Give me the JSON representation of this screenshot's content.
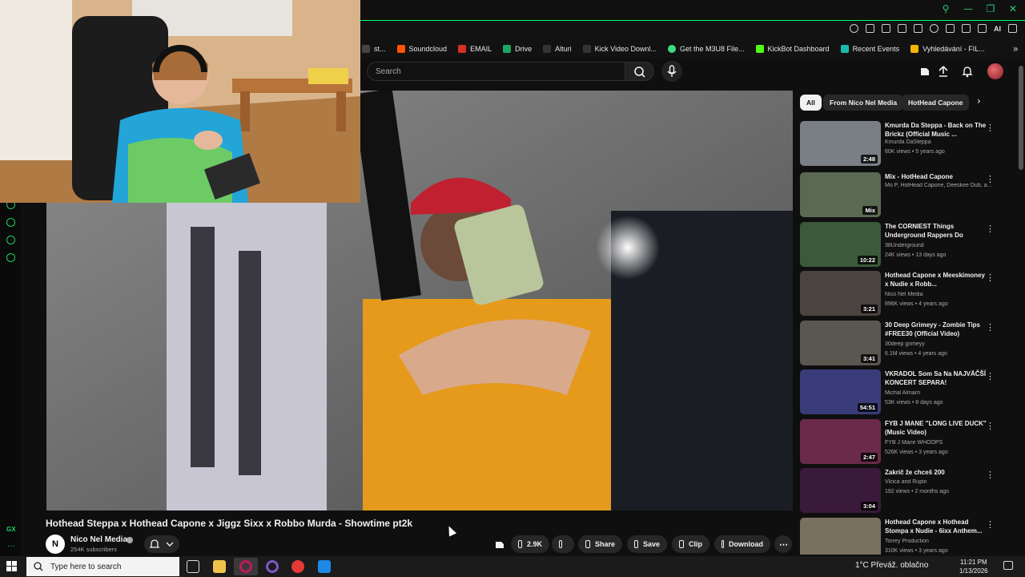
{
  "browser": {
    "bookmarks": [
      {
        "label": "st...",
        "color": "#444444"
      },
      {
        "label": "Soundcloud",
        "color": "#ff5500"
      },
      {
        "label": "EMAIL",
        "color": "#d93025"
      },
      {
        "label": "Drive",
        "color": "#1fa463"
      },
      {
        "label": "Alturi",
        "color": "#333333"
      },
      {
        "label": "Kick Video Downl...",
        "color": "#333333"
      },
      {
        "label": "Get the M3U8 File...",
        "color": "#3ddc84"
      },
      {
        "label": "KickBot Dashboard",
        "color": "#53fc18"
      },
      {
        "label": "Recent Events",
        "color": "#1db9a8"
      },
      {
        "label": "Vyhledávání - FIL...",
        "color": "#f5b400"
      }
    ],
    "toolbar_ai_label": "AI",
    "gx_label": "GX",
    "gx_dots": "···",
    "accent": "#1fd162"
  },
  "youtube": {
    "search_placeholder": "Search",
    "chips": [
      {
        "label": "All",
        "active": true
      },
      {
        "label": "From Nico Nel Media",
        "active": false
      },
      {
        "label": "HotHead Capone",
        "active": false
      }
    ],
    "video": {
      "title": "Hothead Steppa x Hothead Capone x Jiggz Sixx x Robbo Murda - Showtime pt2k",
      "channel_initial": "N",
      "channel": "Nico Nel Media",
      "subscribers": "254K subscribers",
      "likes": "2.9K",
      "share_label": "Share",
      "save_label": "Save",
      "clip_label": "Clip",
      "download_label": "Download"
    },
    "recommendations": [
      {
        "title": "Kmurda Da Steppa - Back on The Brickz (Official Music ...",
        "channel": "Kmurda DaSteppa",
        "meta": "60K views • 5 years ago",
        "duration": "2:48",
        "thumb": "#7a7f86"
      },
      {
        "title": "Mix - HotHead Capone",
        "channel": "Mo P, HotHead Capone, Deeskee Dub, a...",
        "meta": "",
        "duration": "Mix",
        "thumb": "#5a6a52"
      },
      {
        "title": "The CORNIEST Things Underground Rappers Do",
        "channel": "38Underground",
        "meta": "24K views • 13 days ago",
        "duration": "10:22",
        "thumb": "#3a5a3a"
      },
      {
        "title": "Hothead Capone x Meeskimoney x Nudie x Robb...",
        "channel": "Nico Nel Media",
        "meta": "896K views • 4 years ago",
        "duration": "3:21",
        "thumb": "#4a4340"
      },
      {
        "title": "30 Deep Grimeyy - Zombie Tips #FREE30 (Official Video)",
        "channel": "30deep grimeyy",
        "meta": "6.1M views • 4 years ago",
        "duration": "3:41",
        "thumb": "#5a5650"
      },
      {
        "title": "VKRADOL Som Sa Na NAJVÄČŠÍ KONCERT SEPARA!",
        "channel": "Michal Almarri",
        "meta": "53K views • 8 days ago",
        "duration": "54:51",
        "thumb": "#3a3c7a"
      },
      {
        "title": "FYB J MANE \"LONG LIVE DUCK\" (Music Video)",
        "channel": "FYB J Mane WHOOPS",
        "meta": "526K views • 3 years ago",
        "duration": "2:47",
        "thumb": "#6a2a4a"
      },
      {
        "title": "Zakrič že chceš 200",
        "channel": "Vlcica and Rupin",
        "meta": "192 views • 2 months ago",
        "duration": "3:04",
        "thumb": "#3a1a3a"
      },
      {
        "title": "Hothead Capone x Hothead Stompa x Nudie - 6ixx Anthem...",
        "channel": "Torrey Production",
        "meta": "310K views • 3 years ago",
        "duration": "",
        "thumb": "#7a7060"
      }
    ]
  },
  "taskbar": {
    "search_placeholder": "Type here to search",
    "weather": "1°C  Převáž. oblačno",
    "time": "11:21 PM",
    "date": "1/13/2026"
  }
}
